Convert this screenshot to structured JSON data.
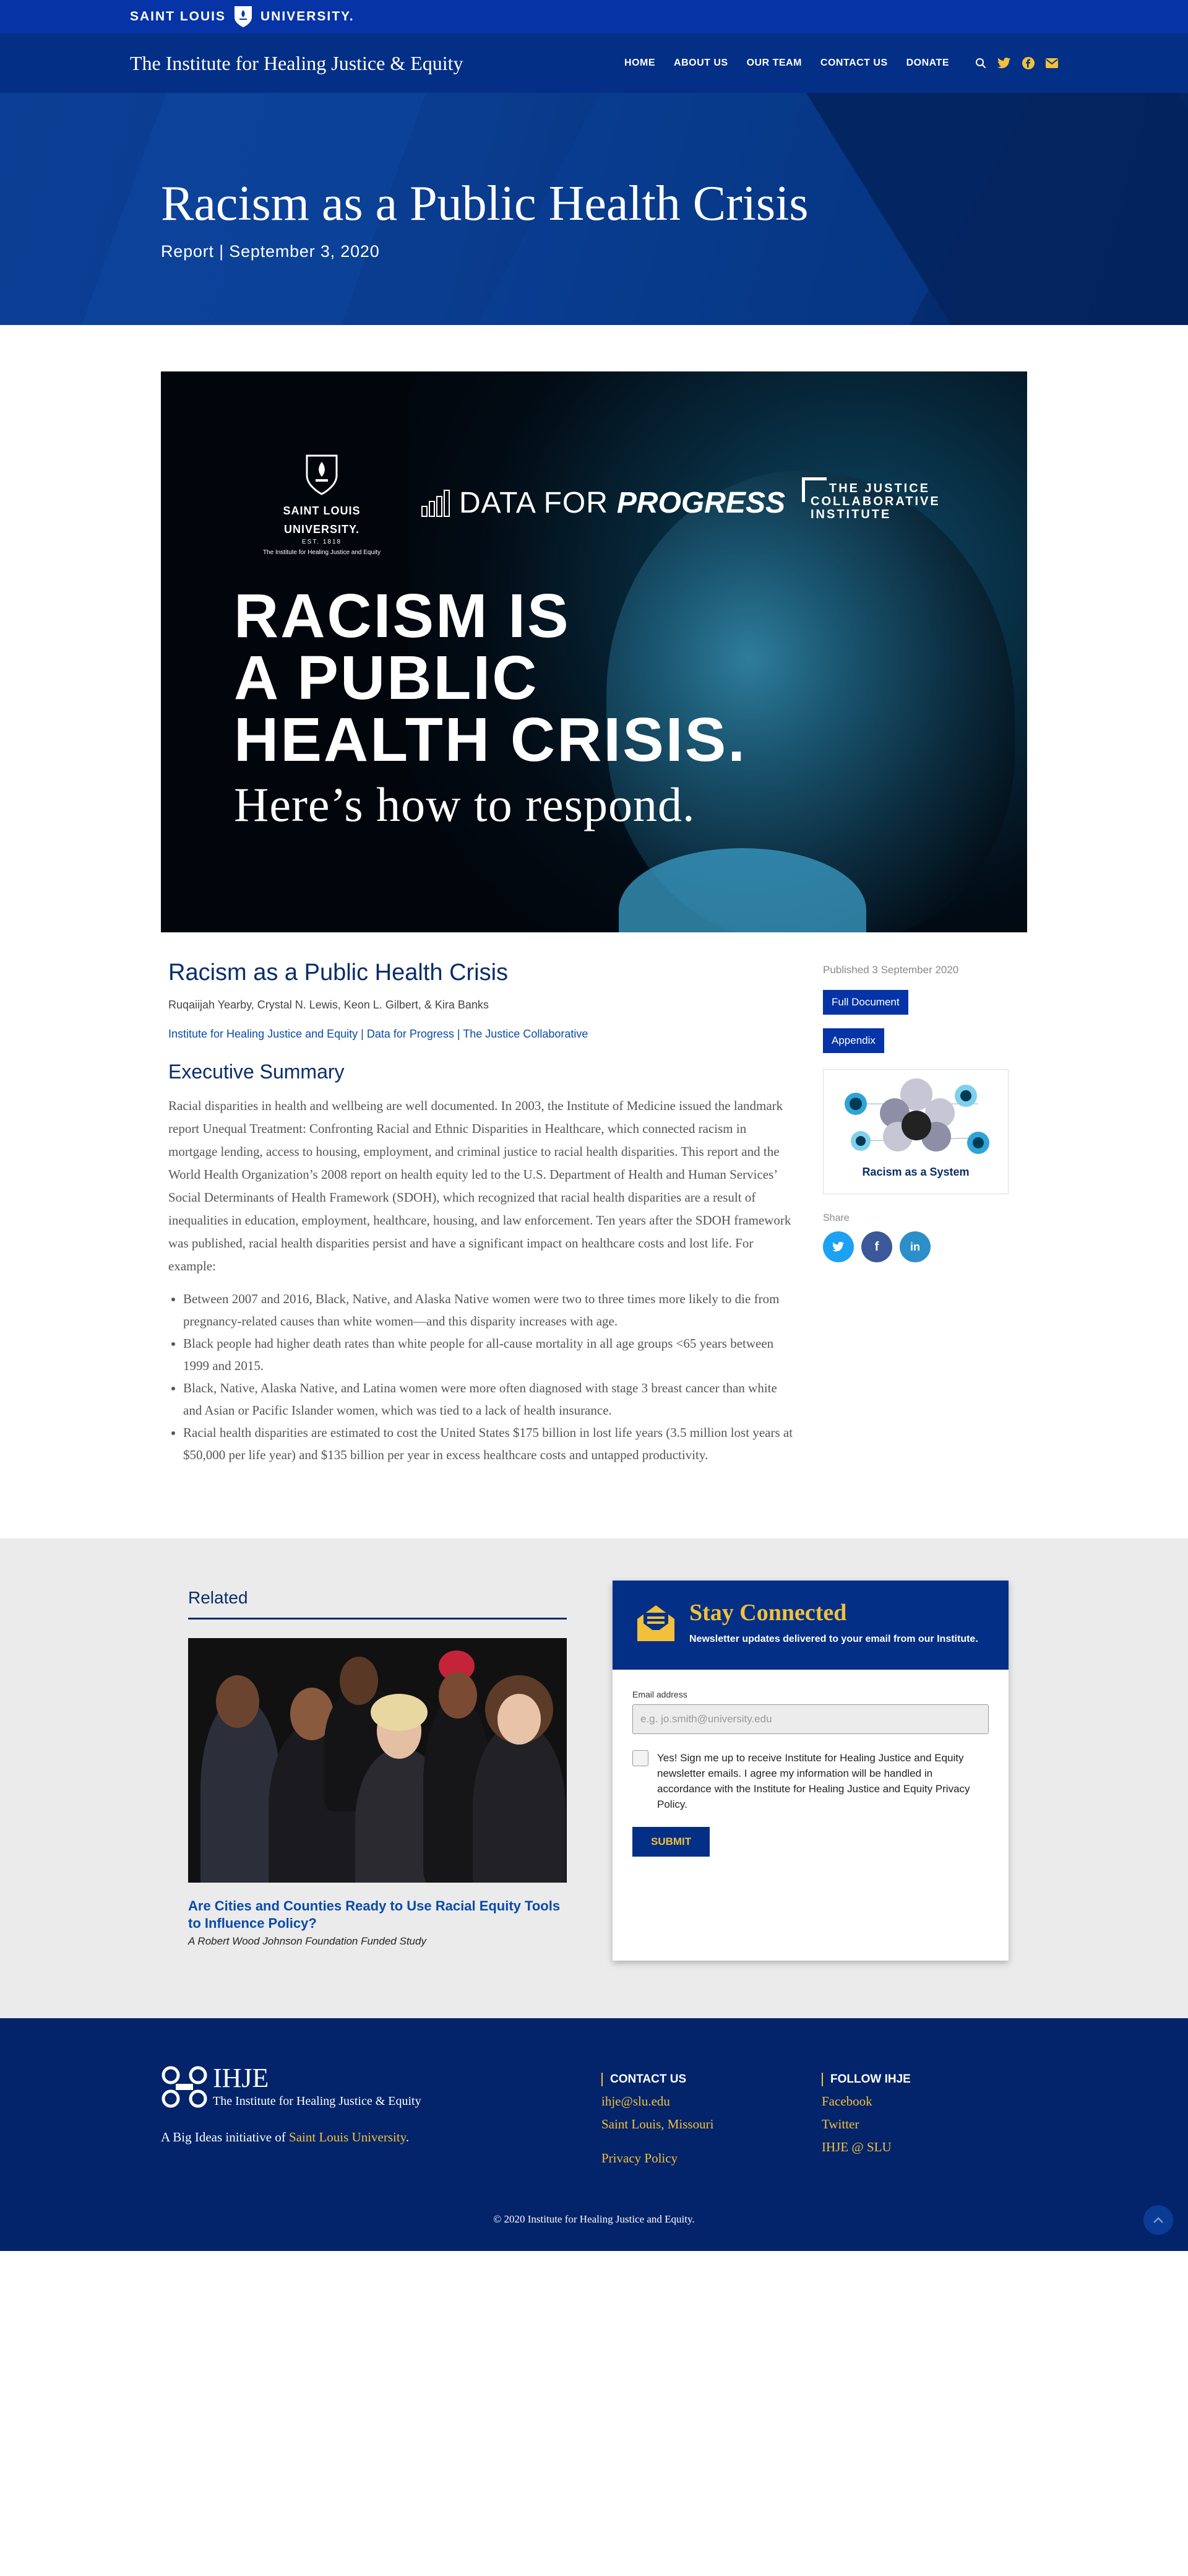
{
  "slu_bar": {
    "logo_text": "SAINT LOUIS UNIVERSITY."
  },
  "nav": {
    "site_title": "The Institute for Healing Justice & Equity",
    "items": [
      {
        "label": "HOME"
      },
      {
        "label": "ABOUT US"
      },
      {
        "label": "OUR TEAM"
      },
      {
        "label": "CONTACT US"
      },
      {
        "label": "DONATE"
      }
    ],
    "icons": [
      "search-icon",
      "twitter-icon",
      "facebook-icon",
      "email-icon"
    ]
  },
  "hero": {
    "title": "Racism as a Public Health Crisis",
    "subtitle": "Report | September 3, 2020"
  },
  "feature_image": {
    "slu_name_1": "SAINT LOUIS",
    "slu_name_2": "UNIVERSITY.",
    "slu_est": "EST. 1818",
    "slu_inst": "The Institute for Healing Justice and Equity",
    "dfp_1": "DATA FOR",
    "dfp_2": "PROGRESS",
    "jci_1": "THE JUSTICE",
    "jci_2": "COLLABORATIVE",
    "jci_3": "INSTITUTE",
    "headline_1": "RACISM IS",
    "headline_2": "A PUBLIC",
    "headline_3": "HEALTH CRISIS.",
    "tagline": "Here’s how to respond."
  },
  "article": {
    "title": "Racism as a Public Health Crisis",
    "authors": "Ruqaiijah Yearby, Crystal N. Lewis, Keon L. Gilbert, & Kira Banks",
    "orgs": [
      {
        "label": "Institute for Healing Justice and Equity"
      },
      {
        "label": "Data for Progress"
      },
      {
        "label": "The Justice Collaborative"
      }
    ],
    "org_separator": " | ",
    "exec_heading": "Executive Summary",
    "summary": "Racial disparities in health and wellbeing are well documented. In 2003, the Institute of Medicine issued the landmark report Unequal Treatment: Confronting Racial and Ethnic Disparities in Healthcare, which connected racism in mortgage lending, access to housing, employment, and criminal justice to racial health disparities. This report and the World Health Organization’s 2008 report on health equity led to the U.S. Department of Health and Human Services’ Social Determinants of Health Framework (SDOH), which recognized that racial health disparities are a result of inequalities in education, employment, healthcare, housing, and law enforcement. Ten years after the SDOH framework was published, racial health disparities persist and have a significant impact on healthcare costs and lost life. For example:",
    "bullets": [
      "Between 2007 and 2016, Black, Native, and Alaska Native women were two to three times more likely to die from pregnancy-related causes than white women—and this disparity increases with age.",
      "Black people had higher death rates than white people for all-cause mortality in all age groups <65 years between 1999 and 2015.",
      "Black, Native, Alaska Native, and Latina women were more often diagnosed with stage 3 breast cancer than white and Asian or Pacific Islander women, which was tied to a lack of health insurance.",
      "Racial health disparities are estimated to cost the United States $175 billion in lost life years (3.5 million lost years at $50,000 per life year) and $135 billion per year in excess healthcare costs and untapped productivity."
    ]
  },
  "sidebar": {
    "published": "Published 3 September 2020",
    "full_document": "Full Document",
    "appendix": "Appendix",
    "thumb_label": "Racism as a System",
    "share_label": "Share",
    "share_icons": [
      {
        "icon": "twitter-icon",
        "glyph": "t",
        "color": "#1da1f2"
      },
      {
        "icon": "facebook-icon",
        "glyph": "f",
        "color": "#3b5998"
      },
      {
        "icon": "linkedin-icon",
        "glyph": "in",
        "color": "#2d8fc9"
      }
    ]
  },
  "related": {
    "heading": "Related",
    "link": "Are Cities and Counties Ready to Use Racial Equity Tools to Influence Policy?",
    "note": "A Robert Wood Johnson Foundation Funded Study"
  },
  "newsletter": {
    "title": "Stay Connected",
    "subtitle": "Newsletter updates delivered to your email from our Institute.",
    "email_label": "Email address",
    "email_placeholder": "e.g. jo.smith@university.edu",
    "consent": "Yes! Sign me up to receive Institute for Healing Justice and Equity newsletter emails. I agree my information will be handled in accordance with the Institute for Healing Justice and Equity Privacy Policy.",
    "submit": "SUBMIT"
  },
  "footer": {
    "brand_big": "IHJE",
    "brand_small": "The Institute for Healing Justice & Equity",
    "initiative_prefix": "A Big Ideas initiative of ",
    "initiative_link": "Saint Louis University",
    "initiative_suffix": ".",
    "contact_heading": "CONTACT US",
    "contact_email": "ihje@slu.edu",
    "contact_location": "Saint Louis, Missouri",
    "privacy": "Privacy Policy",
    "follow_heading": "FOLLOW IHJE",
    "follow_links": [
      {
        "label": "Facebook"
      },
      {
        "label": "Twitter"
      },
      {
        "label": "IHJE @ SLU"
      }
    ],
    "copyright": "© 2020 Institute for Healing Justice and Equity."
  },
  "colors": {
    "brand_blue": "#0634a6",
    "nav_blue": "#032f86",
    "gold": "#f2c03a",
    "footer_blue": "#03246a"
  }
}
